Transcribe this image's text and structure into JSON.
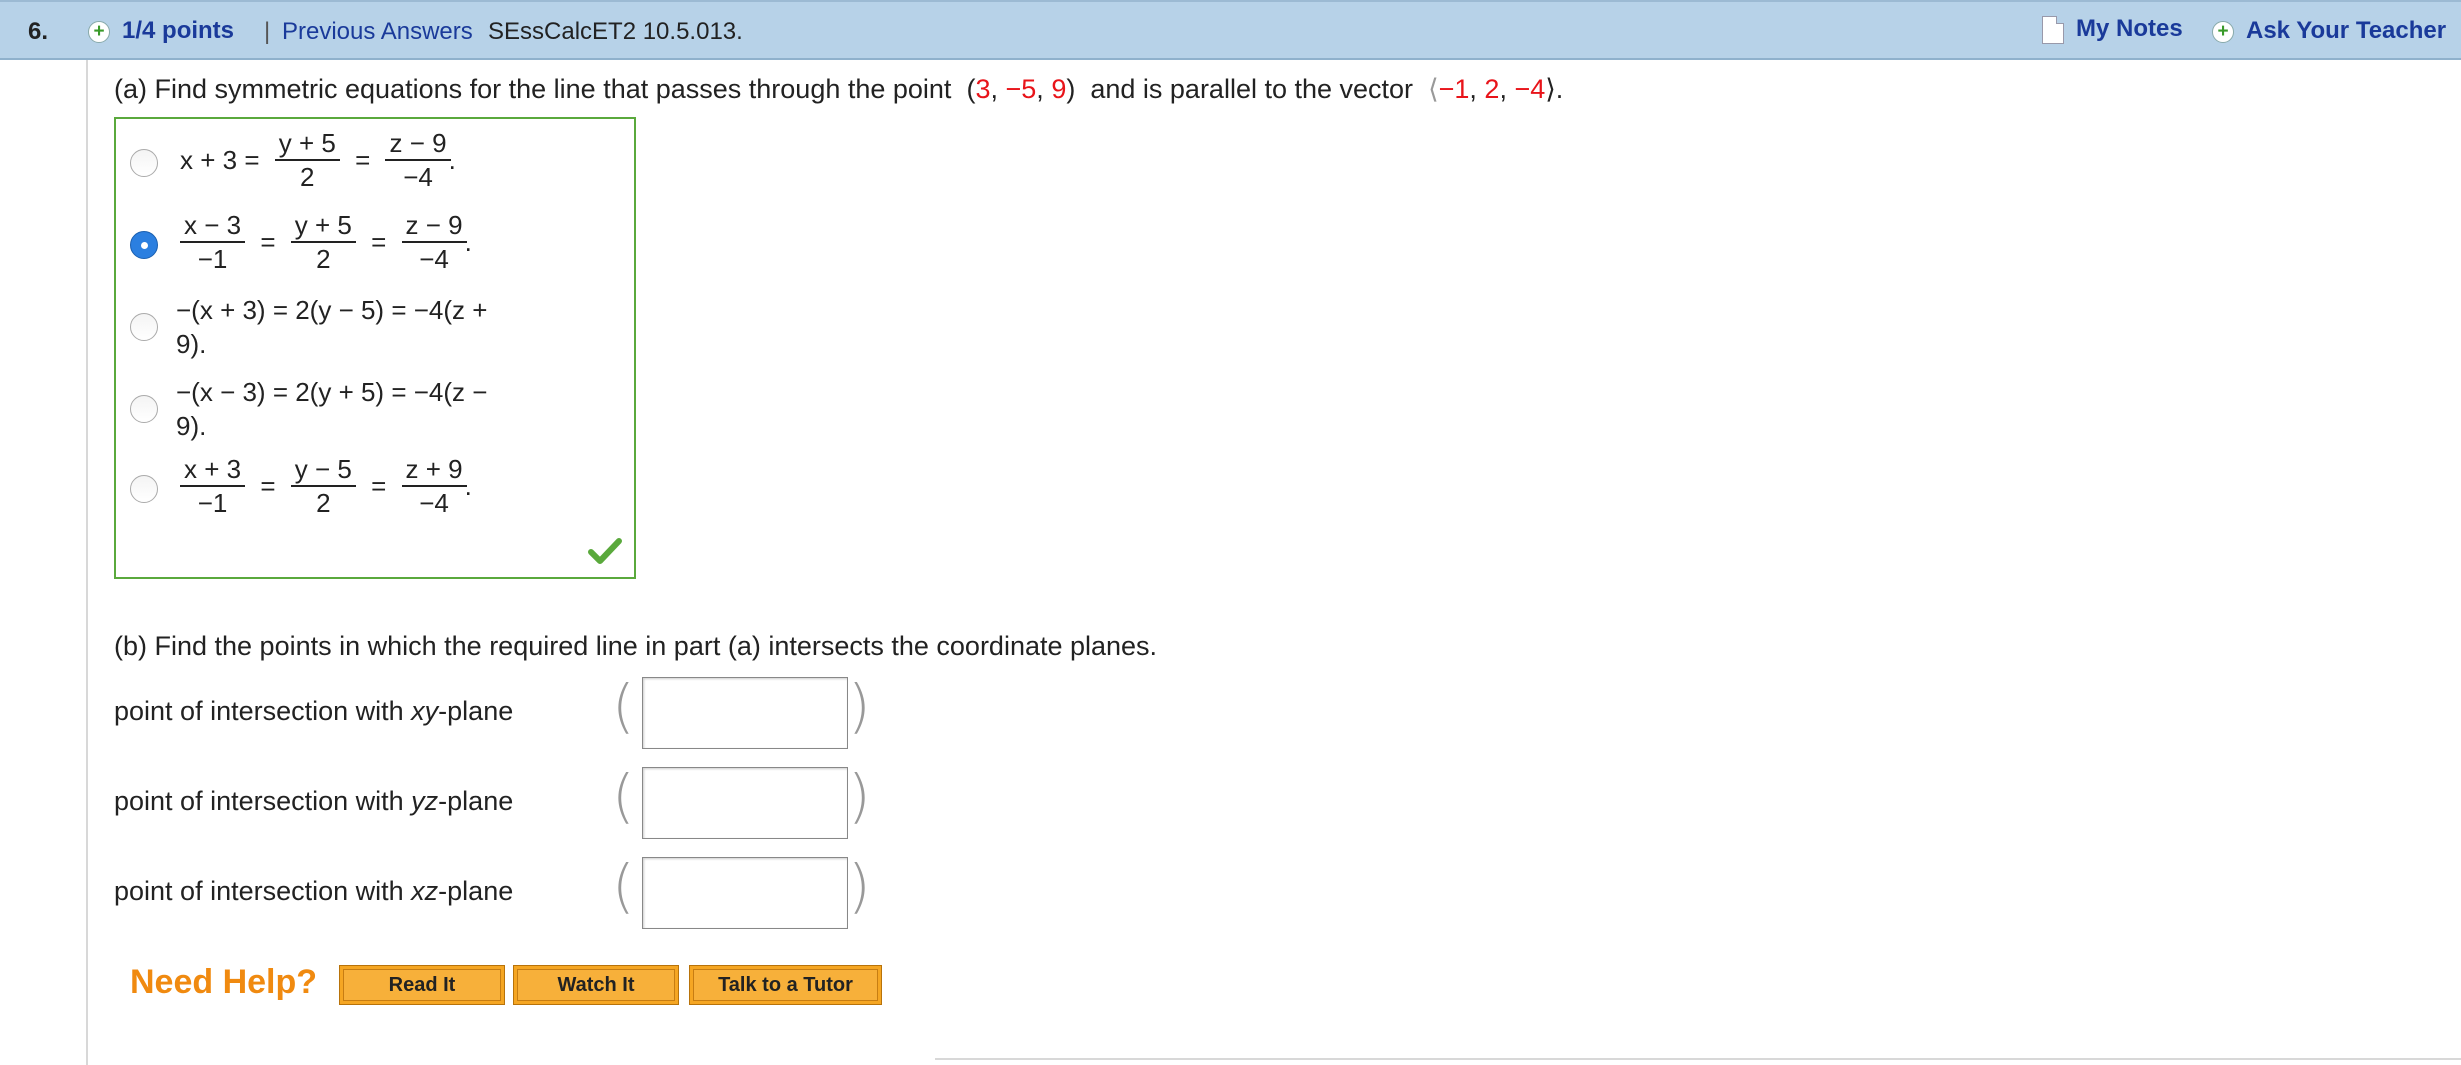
{
  "header": {
    "number": "6.",
    "points": "1/4 points",
    "separator": "|",
    "previous_answers": "Previous Answers",
    "code": "SEssCalcET2 10.5.013.",
    "my_notes": "My Notes",
    "ask_teacher": "Ask Your Teacher"
  },
  "part_a": {
    "prompt": "(a) Find symmetric equations for the line that passes through the point",
    "point_open": "(",
    "point": [
      "3",
      "−5",
      "9"
    ],
    "point_close": ")",
    "mid": "and is parallel to the vector",
    "vector_open": "⟨",
    "vector": [
      "−1",
      "2",
      "−4"
    ],
    "vector_close": "⟩.",
    "options": [
      {
        "selected": false,
        "lead": "x + 3 =",
        "f1_num": "y + 5",
        "f1_den": "2",
        "f2_num": "z − 9",
        "f2_den": "−4",
        "end": "."
      },
      {
        "selected": true,
        "f0_num": "x − 3",
        "f0_den": "−1",
        "f1_num": "y + 5",
        "f1_den": "2",
        "f2_num": "z − 9",
        "f2_den": "−4",
        "end": "."
      },
      {
        "selected": false,
        "line1": "−(x + 3) = 2(y − 5) = −4(z +",
        "line2": "9)."
      },
      {
        "selected": false,
        "line1": "−(x − 3) = 2(y + 5) = −4(z −",
        "line2": "9)."
      },
      {
        "selected": false,
        "f0_num": "x + 3",
        "f0_den": "−1",
        "f1_num": "y − 5",
        "f1_den": "2",
        "f2_num": "z + 9",
        "f2_den": "−4",
        "end": "."
      }
    ]
  },
  "part_b": {
    "prompt": "(b) Find the points in which the required line in part (a) intersects the coordinate planes.",
    "rows": [
      {
        "pre": "point of intersection with ",
        "plane": "xy",
        "post": "-plane",
        "value": ""
      },
      {
        "pre": "point of intersection with ",
        "plane": "yz",
        "post": "-plane",
        "value": ""
      },
      {
        "pre": "point of intersection with ",
        "plane": "xz",
        "post": "-plane",
        "value": ""
      }
    ]
  },
  "help": {
    "label": "Need Help?",
    "buttons": [
      "Read It",
      "Watch It",
      "Talk to a Tutor"
    ]
  },
  "colors": {
    "header_bg": "#b7d2e8",
    "link": "#1a3a9a",
    "highlight_red": "#e8141a",
    "correct_border": "#5aa93c",
    "help_orange": "#f08a10"
  }
}
